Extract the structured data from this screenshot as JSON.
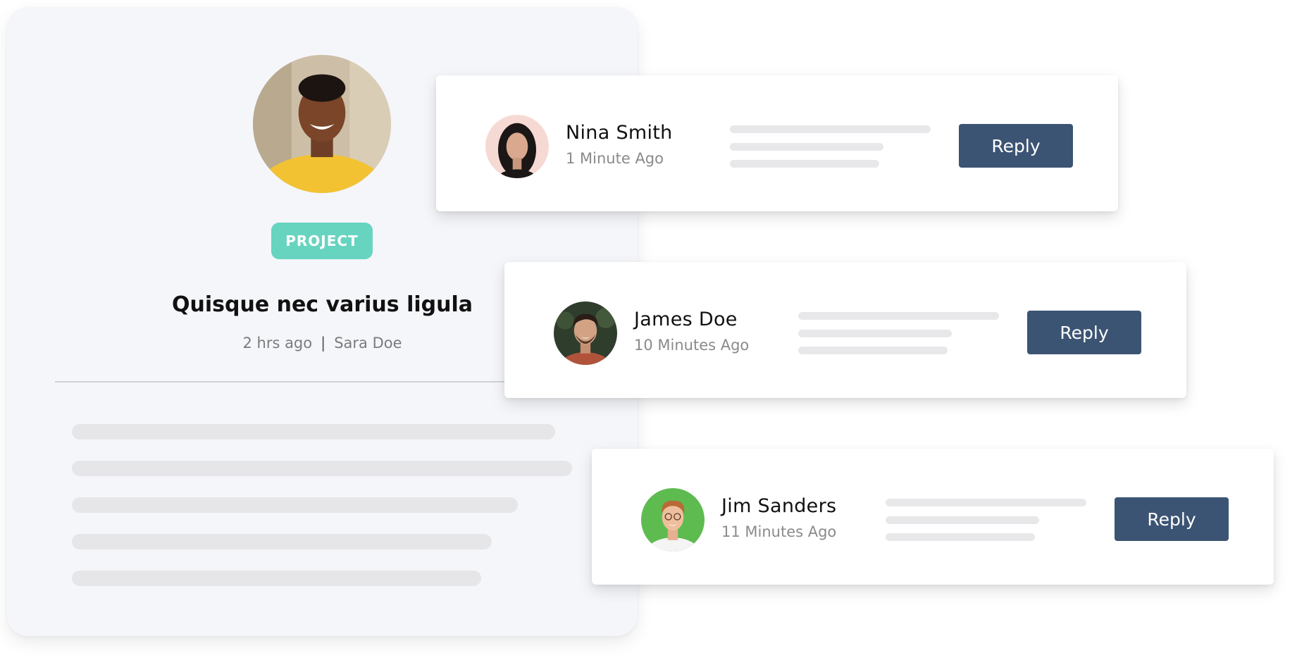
{
  "project": {
    "badge": "PROJECT",
    "title": "Quisque nec varius ligula",
    "time": "2 hrs ago",
    "separator": "|",
    "author": "Sara Doe"
  },
  "comments": [
    {
      "name": "Nina Smith",
      "time": "1 Minute Ago",
      "reply_label": "Reply"
    },
    {
      "name": "James Doe",
      "time": "10 Minutes Ago",
      "reply_label": "Reply"
    },
    {
      "name": "Jim Sanders",
      "time": "11 Minutes Ago",
      "reply_label": "Reply"
    }
  ],
  "colors": {
    "badge": "#67d4c0",
    "reply_button": "#3c5473",
    "card_background": "#f5f6fa",
    "skeleton": "#e6e6e8"
  }
}
